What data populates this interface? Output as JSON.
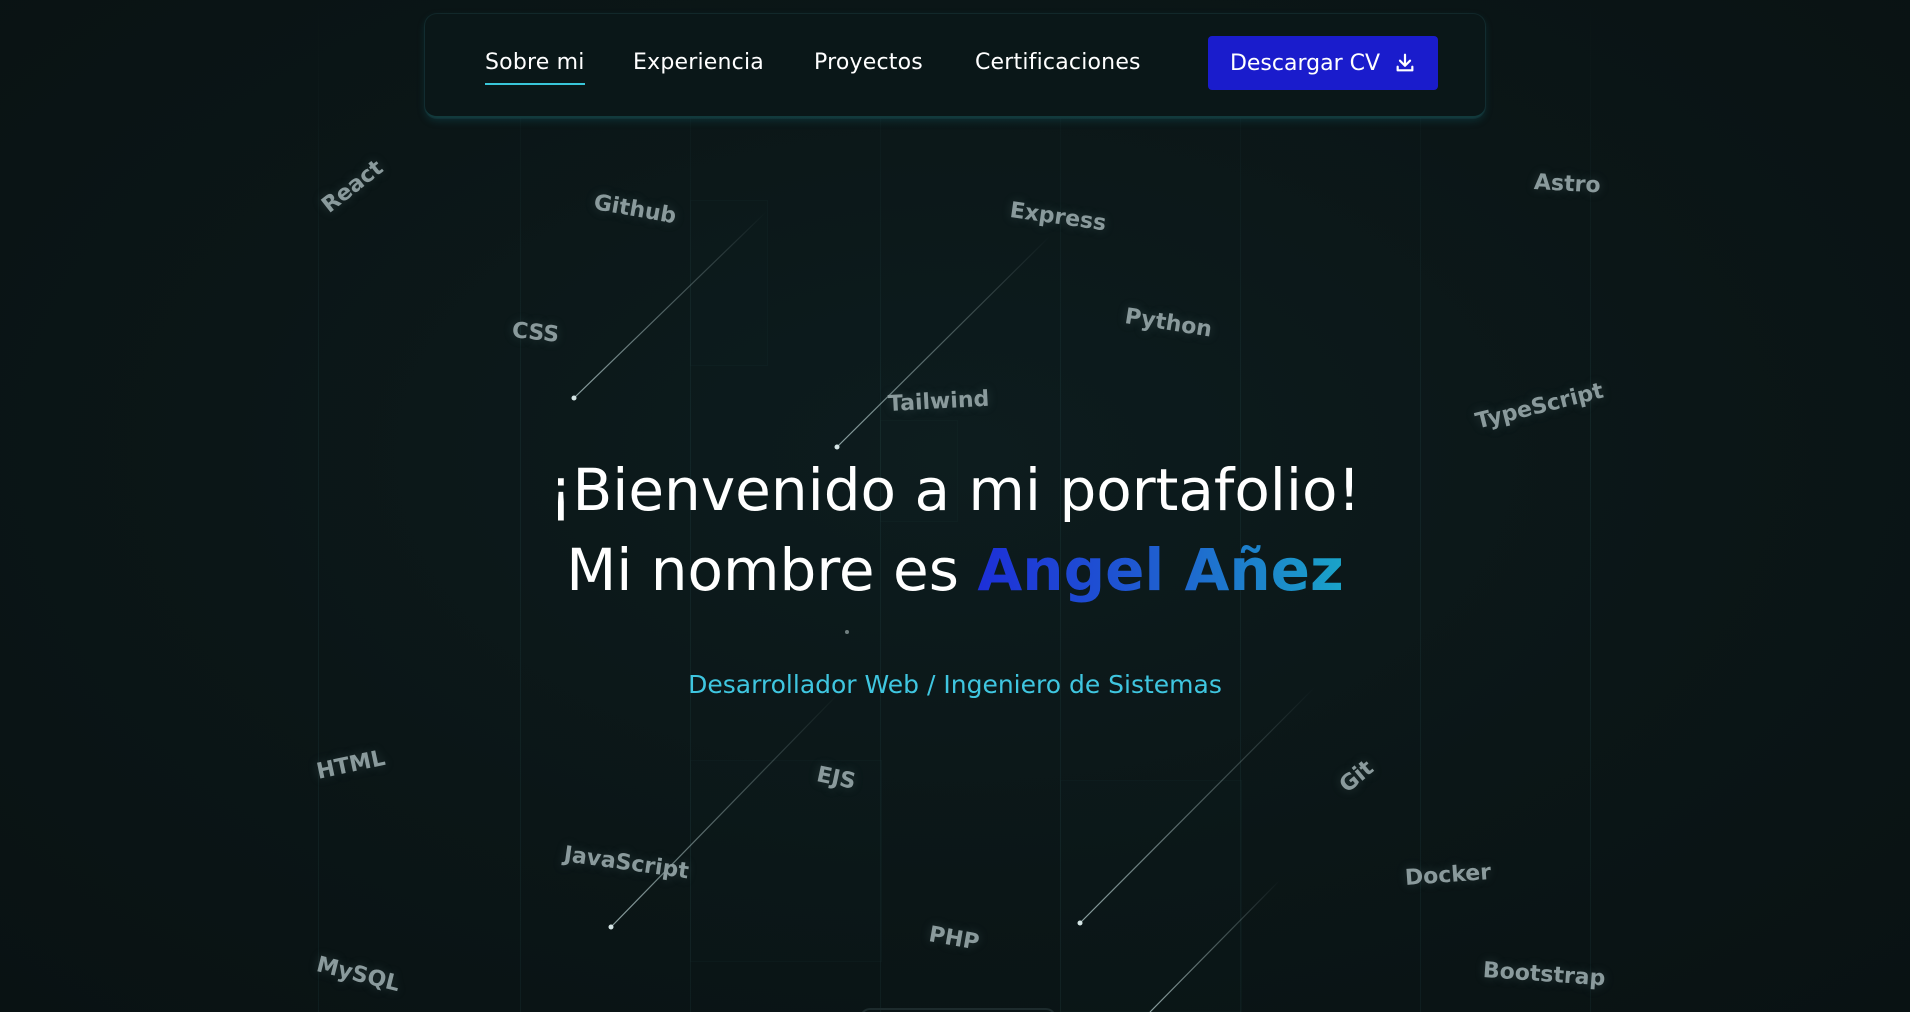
{
  "nav": {
    "links": [
      {
        "label": "Sobre mi",
        "active": true
      },
      {
        "label": "Experiencia",
        "active": false
      },
      {
        "label": "Proyectos",
        "active": false
      },
      {
        "label": "Certificaciones",
        "active": false
      }
    ],
    "cv_button": {
      "label": "Descargar CV",
      "icon": "download-icon"
    }
  },
  "hero": {
    "line1": "¡Bienvenido a mi portafolio!",
    "line2_prefix": "Mi nombre es ",
    "name": "Angel Añez",
    "subtitle": "Desarrollador Web / Ingeniero de Sistemas"
  },
  "technologies": [
    "React",
    "Github",
    "Express",
    "Astro",
    "CSS",
    "Python",
    "Tailwind",
    "TypeScript",
    "HTML",
    "EJS",
    "Git",
    "JavaScript",
    "Docker",
    "PHP",
    "MySQL",
    "Bootstrap"
  ],
  "colors": {
    "background": "#0b1516",
    "accent_cyan": "#39c6d9",
    "button_blue": "#1a1ccc",
    "name_gradient_start": "#1d2fd8",
    "name_gradient_end": "#1aa4c8"
  }
}
